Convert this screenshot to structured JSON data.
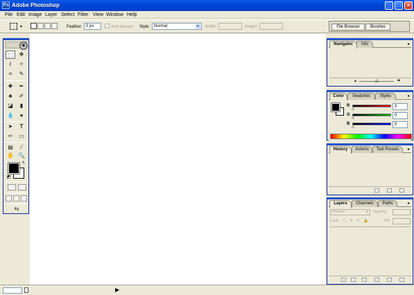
{
  "window": {
    "title": "Adobe Photoshop",
    "icon": "ps-icon",
    "controls": [
      "minimize-icon",
      "maximize-icon",
      "close-icon"
    ]
  },
  "menu": [
    "File",
    "Edit",
    "Image",
    "Layer",
    "Select",
    "Filter",
    "View",
    "Window",
    "Help"
  ],
  "options": {
    "feather_label": "Feather:",
    "feather_value": "0 px",
    "antialiased_label": "Anti-aliased",
    "style_label": "Style:",
    "style_value": "Normal",
    "width_label": "Width:",
    "height_label": "Height:"
  },
  "palette_well": {
    "tabs": [
      "File Browser",
      "Brushes"
    ]
  },
  "navigator": {
    "tabs": [
      "Navigator",
      "Info"
    ]
  },
  "color": {
    "tabs": [
      "Color",
      "Swatches",
      "Styles"
    ],
    "sliders": [
      {
        "label": "R",
        "value": "0",
        "color": "#ff0000"
      },
      {
        "label": "G",
        "value": "0",
        "color": "#00a000"
      },
      {
        "label": "B",
        "value": "0",
        "color": "#0000ff"
      }
    ],
    "foreground": "#000000",
    "background": "#ffffff"
  },
  "history": {
    "tabs": [
      "History",
      "Actions",
      "Tool Presets"
    ]
  },
  "layers": {
    "tabs": [
      "Layers",
      "Channels",
      "Paths"
    ],
    "blend_mode": "Normal",
    "opacity_label": "Opacity:",
    "lock_label": "Lock:",
    "fill_label": "Fill:"
  },
  "statusbar": {
    "zoom": "",
    "arrow": "▶"
  }
}
